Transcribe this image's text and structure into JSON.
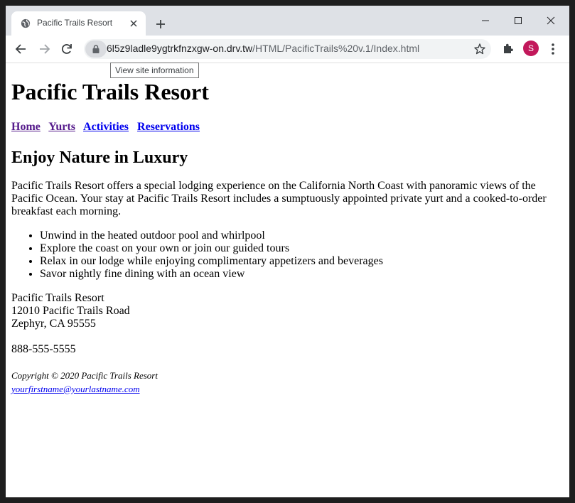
{
  "browser": {
    "tab_title": "Pacific Trails Resort",
    "url_host": "6l5z9ladle9ygtrkfnzxgw-on.drv.tw",
    "url_path": "/HTML/PacificTrails%20v.1/Index.html",
    "tooltip": "View site information",
    "avatar_letter": "S",
    "avatar_color": "#c2185b"
  },
  "page": {
    "title": "Pacific Trails Resort",
    "nav": [
      "Home",
      "Yurts",
      "Activities",
      "Reservations"
    ],
    "heading": "Enjoy Nature in Luxury",
    "intro": "Pacific Trails Resort offers a special lodging experience on the California North Coast with panoramic views of the Pacific Ocean. Your stay at Pacific Trails Resort includes a sumptuously appointed private yurt and a cooked-to-order breakfast each morning.",
    "features": [
      "Unwind in the heated outdoor pool and whirlpool",
      "Explore the coast on your own or join our guided tours",
      "Relax in our lodge while enjoying complimentary appetizers and beverages",
      "Savor nightly fine dining with an ocean view"
    ],
    "address": {
      "name": "Pacific Trails Resort",
      "street": "12010 Pacific Trails Road",
      "city": "Zephyr, CA 95555"
    },
    "phone": "888-555-5555",
    "copyright": "Copyright © 2020 Pacific Trails Resort",
    "email": "yourfirstname@yourlastname.com"
  }
}
